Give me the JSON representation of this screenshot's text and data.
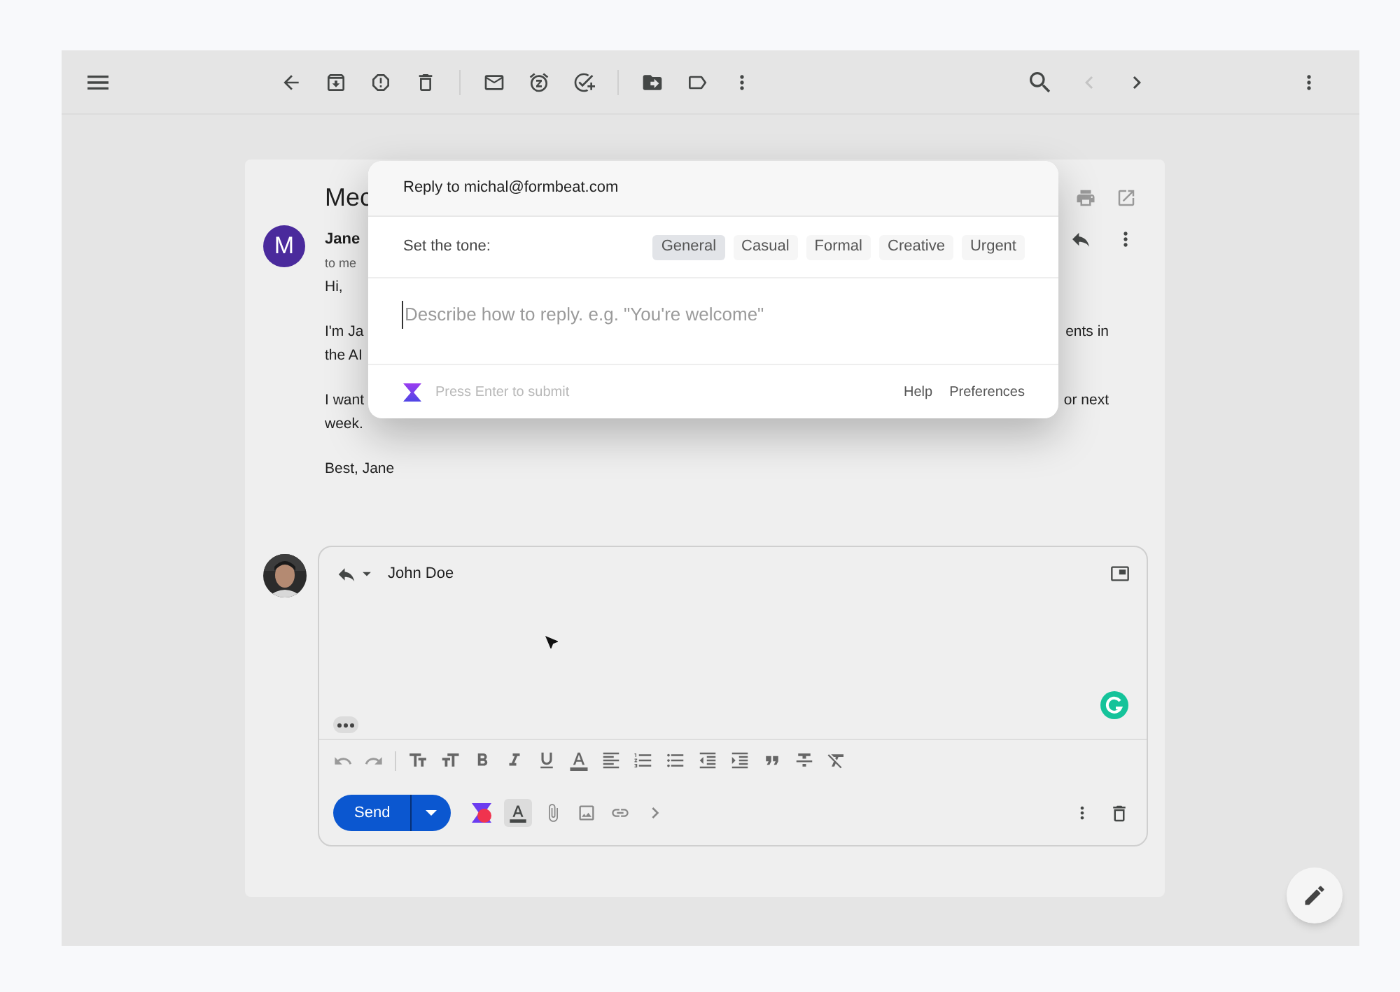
{
  "pager": [
    {
      "disabled": true
    },
    {
      "disabled": false
    }
  ],
  "message": {
    "subject": "Mec",
    "avatar_letter": "M",
    "sender": "Jane",
    "recipient": "to me",
    "body": [
      {
        "left": "Hi,"
      },
      {
        "left": "I'm Ja",
        "right": "ents in"
      },
      {
        "left": "the AI"
      },
      {
        "left": "I want",
        "right": "or next"
      },
      {
        "left": "week."
      },
      {
        "left": "Best, Jane"
      }
    ]
  },
  "compose": {
    "to": "John Doe",
    "send": "Send"
  },
  "assistant": {
    "title": "Reply to michal@formbeat.com",
    "tone_label": "Set the tone:",
    "tones": [
      {
        "label": "General",
        "selected": true
      },
      {
        "label": "Casual",
        "selected": false
      },
      {
        "label": "Formal",
        "selected": false
      },
      {
        "label": "Creative",
        "selected": false
      },
      {
        "label": "Urgent",
        "selected": false
      }
    ],
    "placeholder": "Describe how to reply. e.g. \"You're welcome\"",
    "hint": "Press Enter to submit",
    "links": [
      "Help",
      "Preferences"
    ]
  }
}
